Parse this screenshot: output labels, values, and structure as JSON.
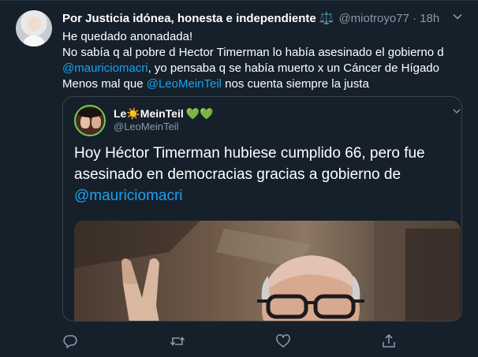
{
  "tweet": {
    "display_name": "Por Justicia idónea, honesta e independiente",
    "name_emoji": "⚖️",
    "handle": "@miotroyo77",
    "separator": "·",
    "time": "18h",
    "lines": [
      {
        "text": "He quedado anonadada!"
      },
      {
        "text": "No sabía q al pobre d Hector Timerman lo había asesinado el gobierno d"
      },
      {
        "link": "@mauriciomacri",
        "after": ", yo pensaba q se había muerto x un Cáncer de Hígado"
      },
      {
        "before": "Menos mal que ",
        "link": "@LeoMeinTeil",
        "after": " nos cuenta siempre la justa"
      }
    ]
  },
  "quoted": {
    "display_name_prefix": "Le",
    "display_name_sun": "☀️",
    "display_name_suffix": "MeinTeil",
    "hearts": "💚💚",
    "handle": "@LeoMeinTeil",
    "text": "Hoy Héctor Timerman hubiese cumplido 66, pero fue asesinado en democracias gracias a gobierno de",
    "mention": "@mauriciomacri",
    "image_desc_icon": "photo-of-man-with-glasses-victory-sign"
  },
  "actions": {
    "icons": [
      "reply-icon",
      "retweet-icon",
      "like-icon",
      "share-icon"
    ]
  },
  "colors": {
    "background": "#15202b",
    "link": "#1da1f2",
    "secondary": "#8899a6",
    "border": "#38444d"
  }
}
